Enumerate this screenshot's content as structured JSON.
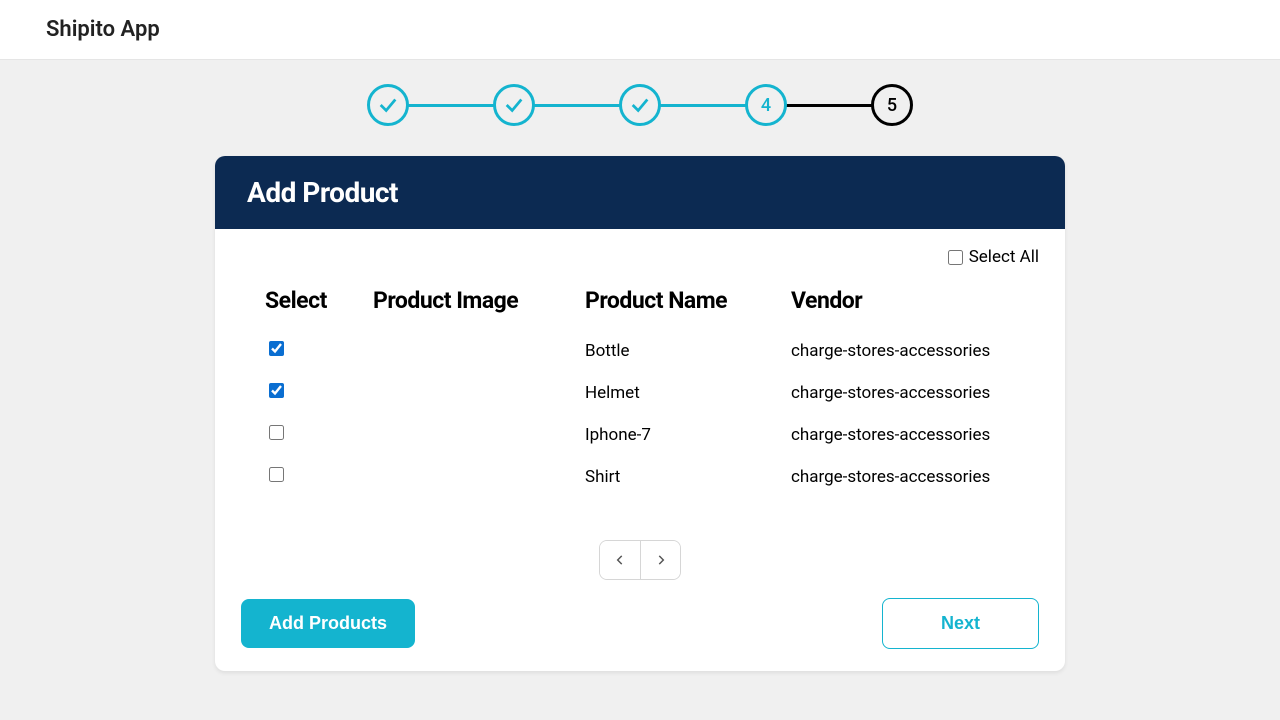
{
  "app": {
    "title": "Shipito App"
  },
  "stepper": {
    "steps": [
      {
        "state": "done"
      },
      {
        "state": "done"
      },
      {
        "state": "done"
      },
      {
        "state": "active",
        "label": "4"
      },
      {
        "state": "pending",
        "label": "5"
      }
    ]
  },
  "card": {
    "title": "Add Product",
    "select_all_label": "Select All",
    "columns": {
      "select": "Select",
      "image": "Product Image",
      "name": "Product Name",
      "vendor": "Vendor"
    },
    "rows": [
      {
        "checked": true,
        "name": "Bottle",
        "vendor": "charge-stores-accessories"
      },
      {
        "checked": true,
        "name": "Helmet",
        "vendor": "charge-stores-accessories"
      },
      {
        "checked": false,
        "name": "Iphone-7",
        "vendor": "charge-stores-accessories"
      },
      {
        "checked": false,
        "name": "Shirt",
        "vendor": "charge-stores-accessories"
      }
    ],
    "actions": {
      "add": "Add Products",
      "next": "Next"
    }
  }
}
